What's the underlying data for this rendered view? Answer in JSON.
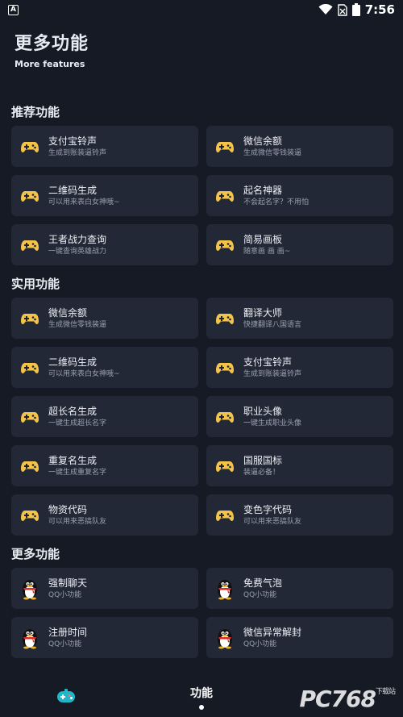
{
  "status_bar": {
    "time": "7:56",
    "notification_glyph": "A"
  },
  "header": {
    "title": "更多功能",
    "subtitle": "More features"
  },
  "sections": [
    {
      "title": "推荐功能",
      "items": [
        {
          "name": "支付宝铃声",
          "desc": "生成到账装逼铃声",
          "icon": "gamepad-icon"
        },
        {
          "name": "微信余额",
          "desc": "生成微信零钱装逼",
          "icon": "gamepad-icon"
        },
        {
          "name": "二维码生成",
          "desc": "可以用来表白女神哦~",
          "icon": "gamepad-icon"
        },
        {
          "name": "起名神器",
          "desc": "不会起名字？不用怕",
          "icon": "gamepad-icon"
        },
        {
          "name": "王者战力查询",
          "desc": "一键查询英雄战力",
          "icon": "gamepad-icon"
        },
        {
          "name": "简易画板",
          "desc": "随意画 画 画~",
          "icon": "gamepad-icon"
        }
      ]
    },
    {
      "title": "实用功能",
      "items": [
        {
          "name": "微信余额",
          "desc": "生成微信零钱装逼",
          "icon": "gamepad-icon"
        },
        {
          "name": "翻译大师",
          "desc": "快捷翻译八国语言",
          "icon": "gamepad-icon"
        },
        {
          "name": "二维码生成",
          "desc": "可以用来表白女神哦~",
          "icon": "gamepad-icon"
        },
        {
          "name": "支付宝铃声",
          "desc": "生成到账装逼铃声",
          "icon": "gamepad-icon"
        },
        {
          "name": "超长名生成",
          "desc": "一键生成超长名字",
          "icon": "gamepad-icon"
        },
        {
          "name": "职业头像",
          "desc": "一键生成职业头像",
          "icon": "gamepad-icon"
        },
        {
          "name": "重复名生成",
          "desc": "一键生成重复名字",
          "icon": "gamepad-icon"
        },
        {
          "name": "国服国标",
          "desc": "装逼必备！",
          "icon": "gamepad-icon"
        },
        {
          "name": "物资代码",
          "desc": "可以用来恶搞队友",
          "icon": "gamepad-icon"
        },
        {
          "name": "变色字代码",
          "desc": "可以用来恶搞队友",
          "icon": "gamepad-icon"
        }
      ]
    },
    {
      "title": "更多功能",
      "items": [
        {
          "name": "强制聊天",
          "desc": "QQ小功能",
          "icon": "qq-penguin-icon"
        },
        {
          "name": "免费气泡",
          "desc": "QQ小功能",
          "icon": "qq-penguin-icon"
        },
        {
          "name": "注册时间",
          "desc": "QQ小功能",
          "icon": "qq-penguin-icon"
        },
        {
          "name": "微信异常解封",
          "desc": "QQ小功能",
          "icon": "qq-penguin-icon"
        }
      ]
    }
  ],
  "bottom_nav": {
    "active_label": "功能",
    "left_icon": "game-controller-icon"
  },
  "watermark": {
    "text": "PC768",
    "small": "下载站"
  },
  "colors": {
    "background": "#151a24",
    "card": "#222836",
    "gamepad": "#f3c34a"
  }
}
